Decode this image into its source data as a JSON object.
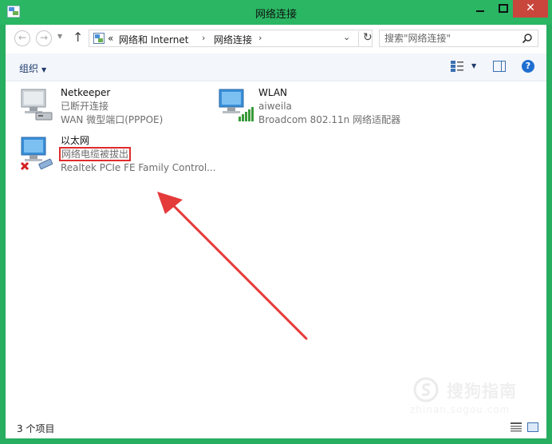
{
  "window": {
    "title": "网络连接",
    "close_glyph": "✕",
    "colors": {
      "titlebar": "#2ab663",
      "border": "#27ae60",
      "close": "#c9463d"
    }
  },
  "address_bar": {
    "back_glyph": "←",
    "forward_glyph": "→",
    "up_glyph": "↑",
    "breadcrumb_prefix": "«",
    "breadcrumb": [
      "网络和 Internet",
      "网络连接"
    ],
    "separator": "›",
    "dropdown_glyph": "⌄",
    "refresh_glyph": "↻",
    "search_placeholder": "搜索\"网络连接\""
  },
  "toolbar": {
    "organize_label": "组织",
    "organize_caret": "▼",
    "view_caret": "▼",
    "help_glyph": "?"
  },
  "connections": [
    {
      "name": "Netkeeper",
      "status": "已断开连接",
      "device": "WAN 微型端口(PPPOE)",
      "icon": "dialup-connection-icon"
    },
    {
      "name": "WLAN",
      "status": "aiweila",
      "device": "Broadcom 802.11n 网络适配器",
      "icon": "wireless-connection-icon"
    },
    {
      "name": "以太网",
      "status": "网络电缆被拔出",
      "device": "Realtek PCIe FE Family Control...",
      "icon": "ethernet-disconnected-icon",
      "highlighted": true
    }
  ],
  "status_bar": {
    "item_count": "3 个项目"
  },
  "watermark": {
    "text": "搜狗指南",
    "url": "zhinan.sogou.com"
  },
  "annotation": {
    "arrow_color": "#e53a3a",
    "highlight_color": "#e02b2b"
  }
}
